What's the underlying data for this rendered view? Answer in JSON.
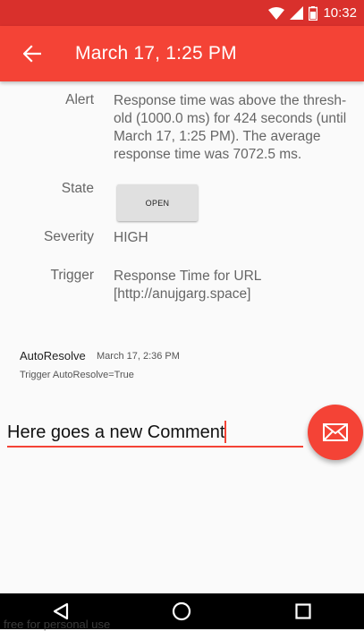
{
  "status_bar": {
    "time": "10:32",
    "icons": [
      "wifi-icon",
      "signal-icon",
      "battery-icon"
    ]
  },
  "app_bar": {
    "title": "March 17, 1:25 PM",
    "back_icon": "arrow-back-icon"
  },
  "details": {
    "alert_label": "Alert",
    "alert_value": "Response time was above the thresh-old (1000.0 ms) for 424 seconds (until March 17, 1:25 PM). The average response time was 7072.5 ms.",
    "state_label": "State",
    "state_button": "OPEN",
    "severity_label": "Severity",
    "severity_value": "HIGH",
    "trigger_label": "Trigger",
    "trigger_value": "Response Time for URL [http://anujgarg.space]"
  },
  "comment": {
    "author": "AutoResolve",
    "time": "March 17, 2:36 PM",
    "body": "Trigger AutoResolve=True"
  },
  "compose": {
    "value": "Here goes a new Comment",
    "send_icon": "mail-icon"
  },
  "nav": {
    "icons": [
      "back-triangle-icon",
      "home-circle-icon",
      "recents-square-icon"
    ]
  },
  "watermark": "free for personal use",
  "colors": {
    "primary": "#f44336",
    "primary_dark": "#d9302c"
  }
}
